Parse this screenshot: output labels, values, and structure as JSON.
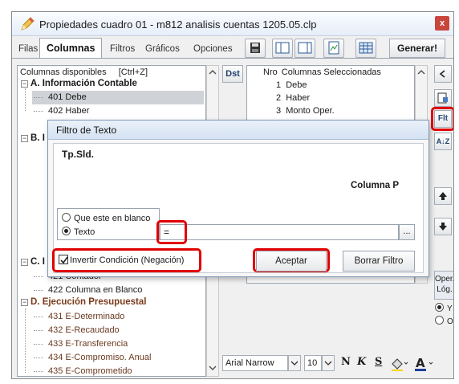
{
  "window": {
    "title": "Propiedades cuadro 01 - m812 analisis cuentas 1205.05.clp",
    "close_label": "x"
  },
  "tabs": [
    "Filas",
    "Columnas",
    "Filtros",
    "Gráficos",
    "Opciones"
  ],
  "active_tab": "Columnas",
  "toolbar": {
    "generar_label": "Generar!"
  },
  "available_columns": {
    "header": "Columnas disponibles",
    "shortcut": "[Ctrl+Z]",
    "group_a": "A. Información Contable",
    "items_a": [
      "401 Debe",
      "402 Haber"
    ],
    "group_b_partial": "B. I",
    "group_c_partial": "C. I",
    "items_c": [
      "421 Contador",
      "422 Columna en Blanco"
    ],
    "group_d": "D. Ejecución Presupuestal",
    "items_d": [
      "431 E-Determinado",
      "432 E-Recaudado",
      "433 E-Transferencia",
      "434 E-Compromiso. Anual",
      "435 E-Comprometido"
    ]
  },
  "dst_label": "Dst",
  "selected_columns": {
    "header_nro": "Nro",
    "header_label": "Columnas Seleccionadas",
    "rows": [
      {
        "nro": "1",
        "label": "Debe"
      },
      {
        "nro": "2",
        "label": "Haber"
      },
      {
        "nro": "3",
        "label": "Monto Oper."
      }
    ]
  },
  "side_buttons": {
    "flt_label": "Flt",
    "sort_label": "A↓Z"
  },
  "oper": {
    "label_1": "Oper.",
    "label_2": "Lóg.",
    "opt_y": "Y",
    "opt_o": "O"
  },
  "format_bar": {
    "font": "Arial Narrow",
    "size": "10"
  },
  "dialog": {
    "title": "Filtro de Texto",
    "field": "Tp.Sld.",
    "column_label": "Columna P",
    "option_blank": "Que este en blanco",
    "option_text": "Texto",
    "text_value": "=",
    "invert_label": "Invertir Condición (Negación)",
    "accept_label": "Aceptar",
    "clear_label": "Borrar Filtro",
    "ellipsis": "..."
  },
  "colors": {
    "highlight": "#e00000",
    "group_brown": "#7b3a1a"
  }
}
